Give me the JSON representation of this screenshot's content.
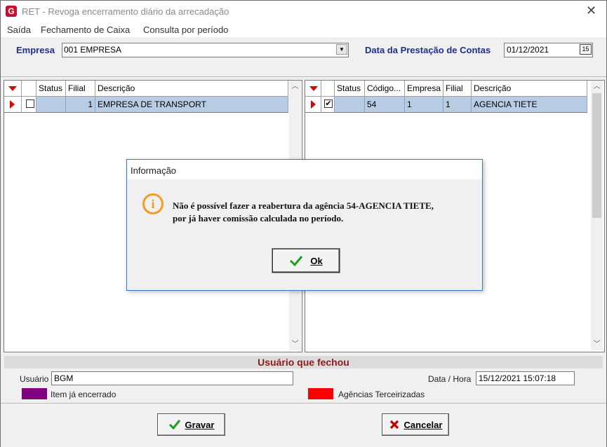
{
  "window": {
    "app_logo": "G",
    "title": "RET - Revoga encerramento diário da arrecadação",
    "close_glyph": "✕"
  },
  "menu": [
    "Saída",
    "Fechamento de Caixa",
    "Consulta por período"
  ],
  "filters": {
    "empresa_label": "Empresa",
    "empresa_value": "001 EMPRESA",
    "data_label": "Data da Prestação de Contas",
    "data_value": "01/12/2021",
    "calendar_glyph": "15"
  },
  "left_grid": {
    "columns": [
      "Status",
      "Filial",
      "Descrição"
    ],
    "rows": [
      {
        "status": "",
        "filial": "1",
        "descricao": "EMPRESA DE TRANSPORT",
        "checked": false
      }
    ]
  },
  "right_grid": {
    "columns": [
      "Status",
      "Código...",
      "Empresa",
      "Filial",
      "Descrição"
    ],
    "rows": [
      {
        "status": "",
        "codigo": "54",
        "empresa": "1",
        "filial": "1",
        "descricao": "AGENCIA TIETE",
        "checked": true
      }
    ]
  },
  "footer": {
    "section_title": "Usuário que fechou",
    "usuario_label": "Usuário",
    "usuario_value": "BGM",
    "datahora_label": "Data / Hora",
    "datahora_value": "15/12/2021 15:07:18",
    "legend_closed": "Item já encerrado",
    "legend_closed_color": "#800080",
    "legend_third": "Agências Terceirizadas",
    "legend_third_color": "#ff0000"
  },
  "buttons": {
    "save": "Gravar",
    "cancel": "Cancelar"
  },
  "dialog": {
    "title": "Informação",
    "line1": "Não é possível fazer a reabertura da agência 54-AGENCIA TIETE,",
    "line2": "por já haver comissão calculada no período.",
    "ok": "Ok"
  },
  "colors": {
    "selection": "#b8cce4",
    "label_blue": "#1f2f8c",
    "section_red": "#8b1a1a",
    "info_orange": "#f39c24"
  }
}
